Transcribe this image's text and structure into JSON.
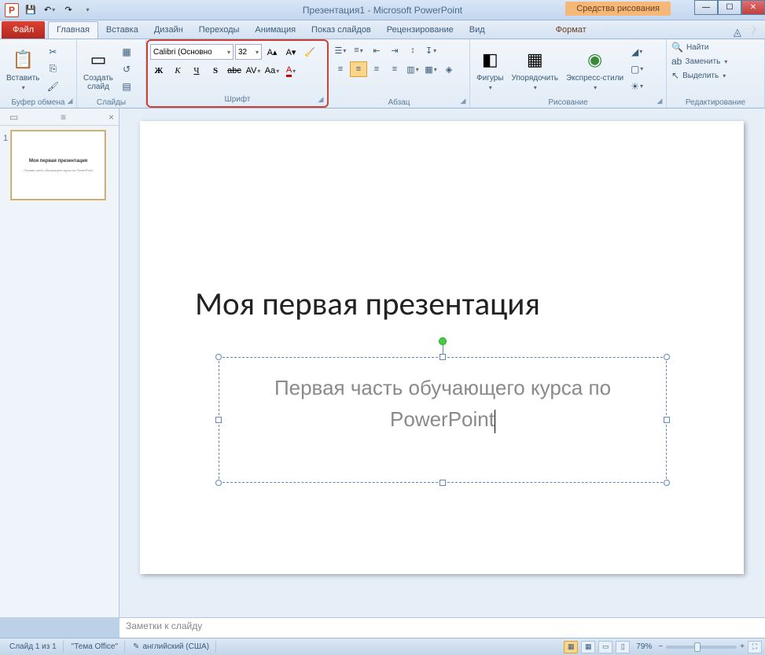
{
  "title": "Презентация1 - Microsoft PowerPoint",
  "context_tab": "Средства рисования",
  "tabs": {
    "file": "Файл",
    "home": "Главная",
    "insert": "Вставка",
    "design": "Дизайн",
    "transitions": "Переходы",
    "animation": "Анимация",
    "slideshow": "Показ слайдов",
    "review": "Рецензирование",
    "view": "Вид",
    "format": "Формат"
  },
  "ribbon": {
    "clipboard": {
      "label": "Буфер обмена",
      "paste": "Вставить"
    },
    "slides": {
      "label": "Слайды",
      "new_slide": "Создать\nслайд"
    },
    "font": {
      "label": "Шрифт",
      "name": "Calibri (Основно",
      "size": "32",
      "bold": "Ж",
      "italic": "К",
      "underline": "Ч",
      "shadow": "S",
      "strike": "abc",
      "spacing": "AV",
      "case": "Aa",
      "color": "A"
    },
    "paragraph": {
      "label": "Абзац"
    },
    "drawing": {
      "label": "Рисование",
      "shapes": "Фигуры",
      "arrange": "Упорядочить",
      "quickstyles": "Экспресс-стили"
    },
    "editing": {
      "label": "Редактирование",
      "find": "Найти",
      "replace": "Заменить",
      "select": "Выделить"
    }
  },
  "slide": {
    "number": "1",
    "title": "Моя первая презентация",
    "subtitle": "Первая часть обучающего курса по PowerPoint",
    "thumb_title": "Моя первая презентация",
    "thumb_sub": "Первая часть обучающего курса по PowerPoint"
  },
  "notes_placeholder": "Заметки к слайду",
  "status": {
    "slide": "Слайд 1 из 1",
    "theme": "\"Тема Office\"",
    "lang": "английский (США)",
    "zoom": "79%"
  }
}
